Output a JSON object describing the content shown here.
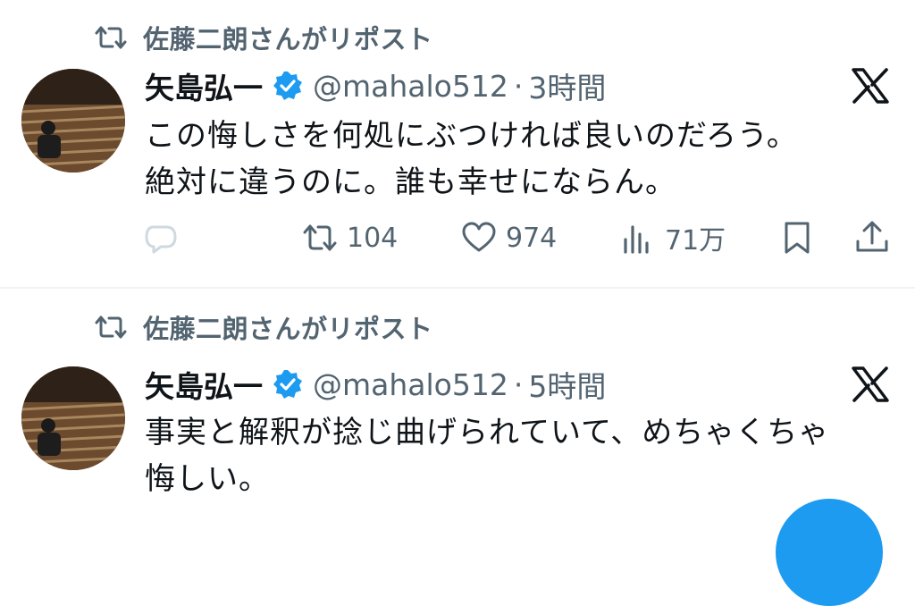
{
  "tweets": [
    {
      "repost_text": "佐藤二朗さんがリポスト",
      "name": "矢島弘一",
      "handle": "@mahalo512",
      "separator": "·",
      "time": "3時間",
      "text_lines": [
        "この悔しさを何処にぶつければ良いのだろう。",
        "絶対に違うのに。誰も幸せにならん。"
      ],
      "reposts": "104",
      "likes": "974",
      "views": "71万"
    },
    {
      "repost_text": "佐藤二朗さんがリポスト",
      "name": "矢島弘一",
      "handle": "@mahalo512",
      "separator": "·",
      "time": "5時間",
      "text_lines": [
        "事実と解釈が捻じ曲げられていて、めちゃくちゃ",
        "悔しい。"
      ]
    }
  ],
  "colors": {
    "accent": "#1d9bf0",
    "secondary_text": "#536471",
    "primary_text": "#0f1419",
    "divider": "#eff3f4"
  },
  "icons": [
    "repost-icon",
    "verified-badge-icon",
    "x-logo-icon",
    "reply-icon",
    "like-icon",
    "views-icon",
    "bookmark-icon",
    "share-icon"
  ]
}
